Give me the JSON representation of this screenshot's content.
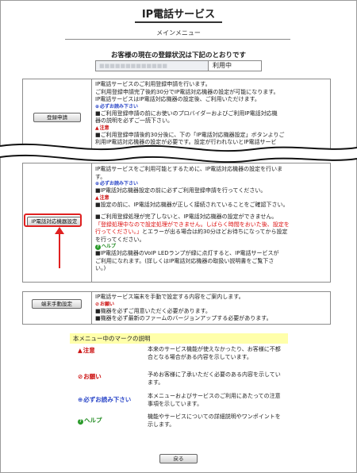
{
  "header": {
    "service_title": "IP電話サービス",
    "main_menu": "メインメニュー"
  },
  "status": {
    "heading": "お客様の現在の登録状況は下記のとおりです",
    "name_placeholder": "■■■■■■■■■■■■■",
    "value": "利用中"
  },
  "section_register": {
    "button": "登録申請",
    "line1": "IP電話サービスのご利用登録申請を行います。",
    "line2": "ご利用登録申請完了後約30分でIP電話対応機器の設定が可能になります。",
    "line3": "IP電話サービスはIP電話対応機器の設定後、ご利用いただけます。",
    "mustread": "必ずお読み下さい",
    "line4": "■ご利用登録申請の前にお使いのプロバイダーおよびご利用IP電話対応機",
    "line5": "器の説明を必ずご一読下さい。",
    "warn": "注意",
    "line6": "■ご利用登録申請後約30分後に、下の「IP電話対応機器設定」ボタンよりご",
    "line7": "利用IP電話対応機器の設定が必要です。設定が行われないとIP電話サービ"
  },
  "section_device": {
    "button": "IP電話対応機器設定",
    "line1": "IP電話サービスをご利用可能とするために、IP電話対応機器の設定を行いま",
    "line2": "す。",
    "mustread": "必ずお読み下さい",
    "line3": "■IP電話対応機器設定の前に必ずご利用登録申請を行ってください。",
    "warn": "注意",
    "line4": "■設定の前に、IP電話対応機器が正しく接続されていることをご確認下さい。",
    "line5": "■ご利用登録処理が完了しないと、IP電話対応機器の設定ができません。",
    "red1": "「登録処理中なので設定処理ができません。しばらく時間をおいた後、設定を",
    "red2": "行ってください。」",
    "line6": "とエラーが出る場合は約30分ほどお待ちになってから設定",
    "line7": "を行ってください。",
    "help": "ヘルプ",
    "line8": "■IP電話対応機器のVoIP LEDランプが緑に点灯すると、IP電話サービスが",
    "line9": "ご利用になれます。(詳しくはIP電話対応機器の取扱い説明書をご覧下さ",
    "line10": "い。)"
  },
  "section_manual": {
    "button": "端末手動設定",
    "line1": "IP電話サービス端末を手動で設定する内容をご案内します。",
    "request": "お願い",
    "line2": "■機器を必ずご用意いただく必要があります。",
    "line3": "■機器を必ず最新のファームのバージョンアップする必要があります。"
  },
  "legend": {
    "heading": "本メニュー中のマークの説明",
    "items": [
      {
        "mark": "注意",
        "desc": "本来のサービス機能が使えなかったり、お客様に不都合となる場合がある内容を示しています。"
      },
      {
        "mark": "お願い",
        "desc": "予めお客様に了承いただく必要のある内容を示しています。"
      },
      {
        "mark": "必ずお読み下さい",
        "desc": "本メニューおよびサービスのご利用にあたっての注意事項を示しています。"
      },
      {
        "mark": "ヘルプ",
        "desc": "機能やサービスについての詳細説明やワンポイントを示します。"
      }
    ]
  },
  "footer": {
    "back_button": "戻る"
  },
  "colors": {
    "warn": "#cc1111",
    "mustread": "#2a46c8",
    "help": "#1f8a1f",
    "legend_bg": "#ffffaa",
    "callout": "#e02020"
  }
}
